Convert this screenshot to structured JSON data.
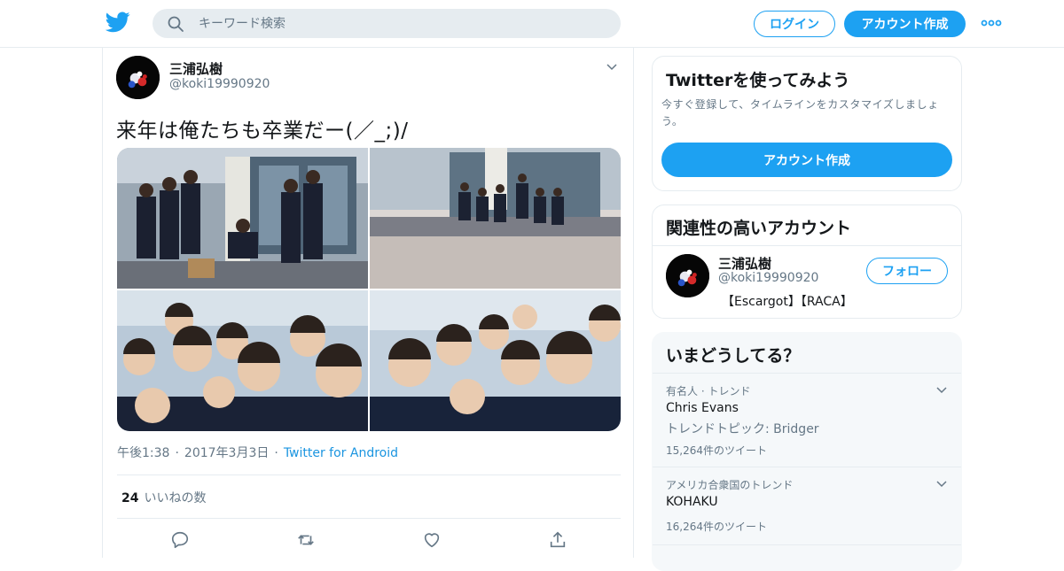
{
  "header": {
    "search_placeholder": "キーワード検索",
    "login_label": "ログイン",
    "signup_label": "アカウント作成"
  },
  "tweet": {
    "author_name": "三浦弘樹",
    "author_handle": "@koki19990920",
    "text": "来年は俺たちも卒業だー(／_;)/",
    "time": "午後1:38",
    "date": "2017年3月3日",
    "source": "Twitter for Android",
    "like_count": "24",
    "like_label": "いいねの数",
    "photos": [
      "graduation-group-photo-1",
      "graduation-group-photo-2",
      "selfie-group-photo-1",
      "selfie-group-photo-2"
    ]
  },
  "signup_card": {
    "title": "Twitterを使ってみよう",
    "description": "今すぐ登録して、タイムラインをカスタマイズしましょう。",
    "button_label": "アカウント作成"
  },
  "related_card": {
    "title": "関連性の高いアカウント",
    "account": {
      "name": "三浦弘樹",
      "handle": "@koki19990920",
      "bio": "【Escargot】【RACA】",
      "follow_label": "フォロー"
    }
  },
  "trends_card": {
    "title": "いまどうしてる？",
    "items": [
      {
        "context": "有名人 · トレンド",
        "name": "Chris Evans",
        "topic": "トレンドトピック: Bridger",
        "count": "15,264件のツイート"
      },
      {
        "context": "アメリカ合衆国のトレンド",
        "name": "KOHAKU",
        "count": "16,264件のツイート"
      }
    ]
  },
  "colors": {
    "accent": "#1da1f2",
    "link": "#1b95e0",
    "secondary_text": "#657786",
    "border": "#e6ecf0"
  },
  "icons": [
    "twitter-bird-icon",
    "search-icon",
    "more-icon",
    "caret-down-icon",
    "reply-icon",
    "retweet-icon",
    "like-icon",
    "share-icon",
    "chevron-down-icon"
  ]
}
